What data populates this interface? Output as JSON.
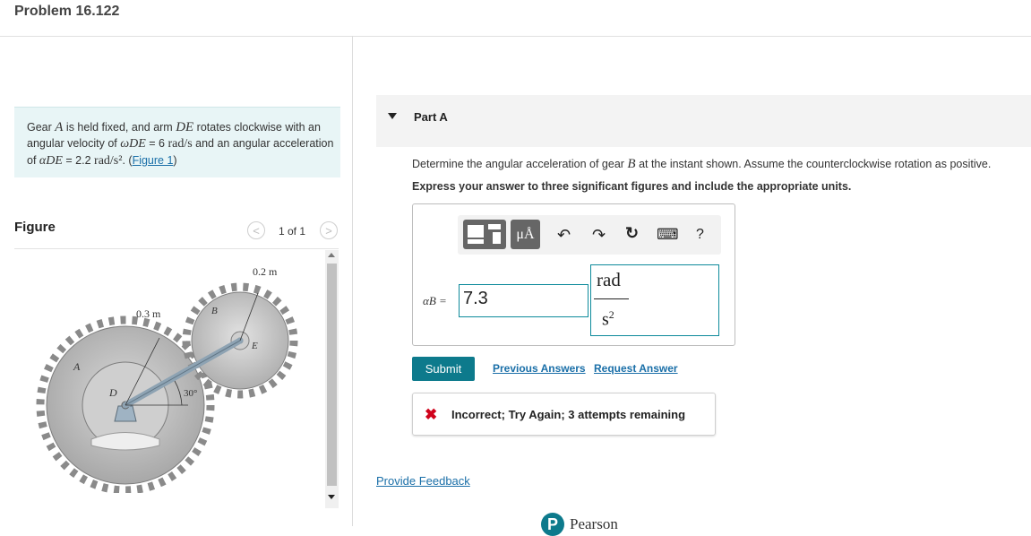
{
  "header": {
    "title": "Problem 16.122"
  },
  "problem": {
    "p1": "Gear ",
    "gear_a": "A",
    "p2": " is held fixed, and arm ",
    "arm": "DE",
    "p3": " rotates clockwise with an angular velocity of ",
    "omega": "ωDE",
    "p4": " = 6 ",
    "omega_units": "rad/s",
    "p5": " and an angular acceleration of ",
    "alpha": "αDE",
    "p6": " = 2.2 ",
    "alpha_units": "rad/s²",
    "p7": ". (",
    "figure_link": "Figure 1",
    "p8": ")"
  },
  "figure": {
    "heading": "Figure",
    "pager": "1 of 1",
    "prev": "<",
    "next": ">",
    "labels": {
      "dim_top": "0.2 m",
      "dim_left": "0.3 m",
      "gear_b": "B",
      "point_e": "E",
      "gear_a": "A",
      "point_d": "D",
      "angle": "30°"
    }
  },
  "part_a": {
    "label": "Part A",
    "q1": "Determine the angular acceleration of gear ",
    "q_var": "B",
    "q2": " at the instant shown. Assume the counterclockwise rotation as positive.",
    "instructions": "Express your answer to three significant figures and include the appropriate units.",
    "toolbar": {
      "units_btn": "μÅ",
      "undo": "↶",
      "redo": "↷",
      "reset": "↻",
      "keyboard": "⌨",
      "help": "?"
    },
    "answer_label": "αB =",
    "answer_value": "7.3",
    "unit_numerator": "rad",
    "unit_denominator": "s",
    "unit_exponent": "2",
    "submit": "Submit",
    "previous_answers": "Previous Answers",
    "request_answer": "Request Answer",
    "feedback_icon": "✖",
    "feedback_text": "Incorrect; Try Again; 3 attempts remaining"
  },
  "footer": {
    "provide_feedback": "Provide Feedback",
    "logo_letter": "P",
    "brand": "Pearson"
  }
}
